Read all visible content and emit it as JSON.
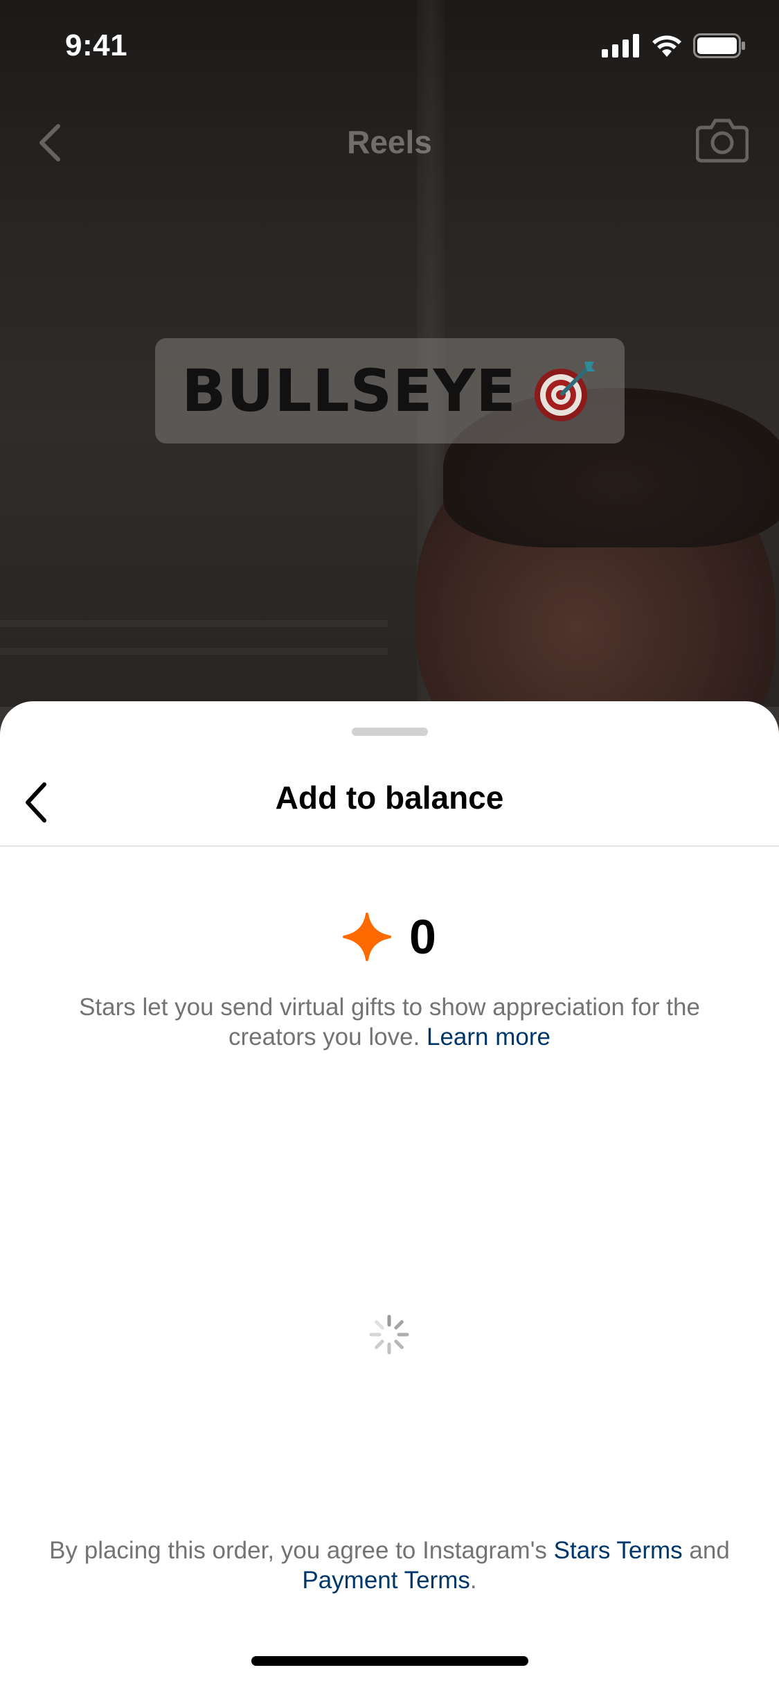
{
  "status_bar": {
    "time": "9:41"
  },
  "background": {
    "header_title": "Reels",
    "sticker_text": "BULLSEYE"
  },
  "sheet": {
    "title": "Add to balance",
    "balance": "0",
    "info_text": "Stars let you send virtual gifts to show appreciation for the creators you love.",
    "learn_more_label": "Learn more",
    "terms_prefix": "By placing this order, you agree to Instagram's",
    "stars_terms_label": "Stars Terms",
    "terms_and": "and",
    "payment_terms_label": "Payment Terms",
    "terms_suffix": "."
  },
  "colors": {
    "star_orange": "#ff6a00",
    "link_blue": "#00376b",
    "body_gray": "#737373"
  }
}
